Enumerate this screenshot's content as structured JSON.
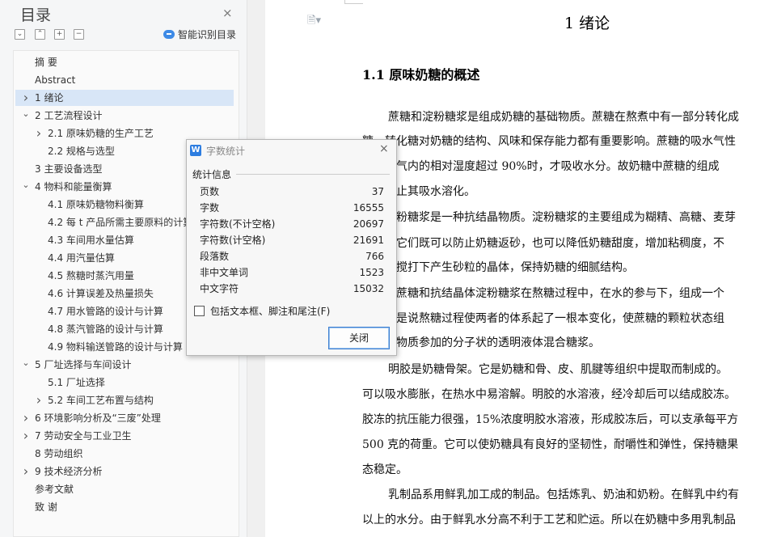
{
  "toc": {
    "title": "目录",
    "close_icon": "×",
    "tools": [
      "⌄",
      "⌃",
      "+",
      "−"
    ],
    "smart_toc_label": "智能识别目录",
    "items": [
      {
        "label": "摘    要",
        "level": 1,
        "caret": "",
        "selected": false
      },
      {
        "label": "Abstract",
        "level": 1,
        "caret": "",
        "selected": false
      },
      {
        "label": "1 绪论",
        "level": 1,
        "caret": "right",
        "selected": true
      },
      {
        "label": "2 工艺流程设计",
        "level": 1,
        "caret": "down",
        "selected": false
      },
      {
        "label": "2.1  原味奶糖的生产工艺",
        "level": 2,
        "caret": "right",
        "selected": false
      },
      {
        "label": "2.2 规格与选型",
        "level": 2,
        "caret": "",
        "selected": false
      },
      {
        "label": "3 主要设备选型",
        "level": 1,
        "caret": "",
        "selected": false
      },
      {
        "label": "4 物料和能量衡算",
        "level": 1,
        "caret": "down",
        "selected": false
      },
      {
        "label": "4.1  原味奶糖物料衡算",
        "level": 2,
        "caret": "",
        "selected": false
      },
      {
        "label": "4.2  每 t 产品所需主要原料的计算",
        "level": 2,
        "caret": "",
        "selected": false
      },
      {
        "label": "4.3  车间用水量估算",
        "level": 2,
        "caret": "",
        "selected": false
      },
      {
        "label": "4.4 用汽量估算",
        "level": 2,
        "caret": "",
        "selected": false
      },
      {
        "label": "4.5 熬糖时蒸汽用量",
        "level": 2,
        "caret": "",
        "selected": false
      },
      {
        "label": "4.6 计算误差及热量损失",
        "level": 2,
        "caret": "",
        "selected": false
      },
      {
        "label": "4.7 用水管路的设计与计算",
        "level": 2,
        "caret": "",
        "selected": false
      },
      {
        "label": "4.8 蒸汽管路的设计与计算",
        "level": 2,
        "caret": "",
        "selected": false
      },
      {
        "label": "4.9 物料输送管路的设计与计算",
        "level": 2,
        "caret": "",
        "selected": false
      },
      {
        "label": "5 厂址选择与车间设计",
        "level": 1,
        "caret": "down",
        "selected": false
      },
      {
        "label": "5.1 厂址选择",
        "level": 2,
        "caret": "",
        "selected": false
      },
      {
        "label": "5.2 车间工艺布置与结构",
        "level": 2,
        "caret": "right",
        "selected": false
      },
      {
        "label": "6 环境影响分析及“三废”处理",
        "level": 1,
        "caret": "right",
        "selected": false
      },
      {
        "label": "7 劳动安全与工业卫生",
        "level": 1,
        "caret": "right",
        "selected": false
      },
      {
        "label": "8 劳动组织",
        "level": 1,
        "caret": "",
        "selected": false
      },
      {
        "label": "9 技术经济分析",
        "level": 1,
        "caret": "right",
        "selected": false
      },
      {
        "label": "参考文献",
        "level": 1,
        "caret": "",
        "selected": false
      },
      {
        "label": "致    谢",
        "level": 1,
        "caret": "",
        "selected": false
      }
    ]
  },
  "document": {
    "chapter_title": "1 绪论",
    "section_title": "1.1 原味奶糖的概述",
    "lines": [
      "蔗糖和淀粉糖浆是组成奶糖的基础物质。蔗糖在熬煮中有一部分转化成",
      "糖，转化糖对奶糖的结构、风味和保存能力都有重要影响。蔗糖的吸水气性",
      "空气内的相对湿度超过 90%时，才吸收水分。故奶糖中蔗糖的组成",
      "防止其吸水溶化。",
      "淀粉糖浆是一种抗结晶物质。淀粉糖浆的主要组成为糊精、高糖、麦芽",
      "。它们既可以防止奶糖返砂，也可以降低奶糖甜度，增加粘稠度，不",
      "烈搅打下产生砂粒的晶体，保持奶糖的细腻结构。",
      "体蔗糖和抗结晶体淀粉糖浆在熬糖过程中，在水的参与下，组成一个",
      "就是说熬糖过程使两者的体系起了一根本变化，使蔗糖的颗粒状态组",
      "晶物质参加的分子状的透明液体混合糖浆。",
      "明胶是奶糖骨架。它是奶糖和骨、皮、肌腱等组织中提取而制成的。",
      "可以吸水膨胀，在热水中易溶解。明胶的水溶液，经冷却后可以结成胶冻。",
      "胶冻的抗压能力很强，15%浓度明胶水溶液，形成胶冻后，可以支承每平方",
      "500 克的荷重。它可以使奶糖具有良好的坚韧性，耐嚼性和弹性，保持糖果",
      "态稳定。",
      "乳制品系用鲜乳加工成的制品。包括炼乳、奶油和奶粉。在鲜乳中约有",
      "以上的水分。由于鲜乳水分高不利于工艺和贮运。所以在奶糖中多用乳制品"
    ]
  },
  "word_count": {
    "title": "字数统计",
    "close_icon": "×",
    "group_label": "统计信息",
    "stats": [
      {
        "label": "页数",
        "value": "37"
      },
      {
        "label": "字数",
        "value": "16555"
      },
      {
        "label": "字符数(不计空格)",
        "value": "20697"
      },
      {
        "label": "字符数(计空格)",
        "value": "21691"
      },
      {
        "label": "段落数",
        "value": "766"
      },
      {
        "label": "非中文单词",
        "value": "1523"
      },
      {
        "label": "中文字符",
        "value": "15032"
      }
    ],
    "include_label": "包括文本框、脚注和尾注(F)",
    "include_checked": false,
    "close_button_label": "关闭"
  }
}
